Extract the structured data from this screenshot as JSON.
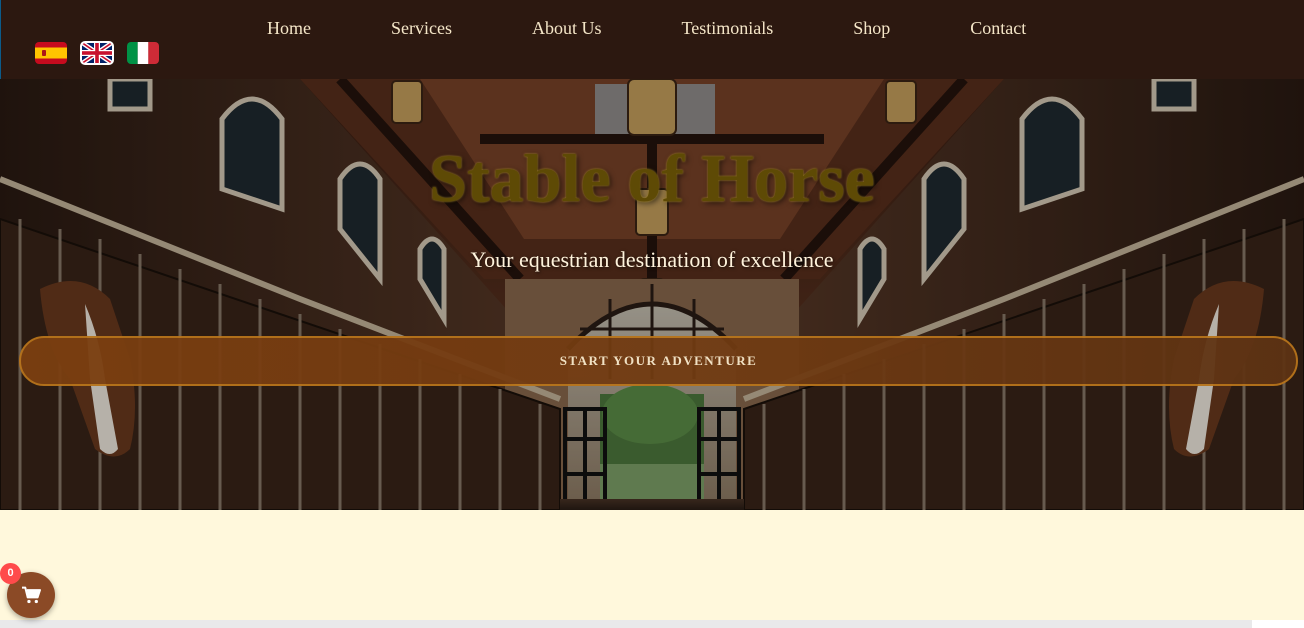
{
  "nav": {
    "items": [
      {
        "label": "Home"
      },
      {
        "label": "Services"
      },
      {
        "label": "About Us"
      },
      {
        "label": "Testimonials"
      },
      {
        "label": "Shop"
      },
      {
        "label": "Contact"
      }
    ]
  },
  "languages": [
    {
      "icon": "spain-flag-icon",
      "active": false
    },
    {
      "icon": "uk-flag-icon",
      "active": true
    },
    {
      "icon": "italy-flag-icon",
      "active": false
    }
  ],
  "hero": {
    "title": "Stable of Horse",
    "subtitle": "Your equestrian destination of excellence",
    "cta_label": "START YOUR ADVENTURE"
  },
  "cart": {
    "count": "0",
    "icon": "shopping-cart-icon"
  },
  "colors": {
    "header_bg": "#2c1810",
    "page_bg": "#fff8dc",
    "cta_bg": "#7c3f10",
    "cta_border": "#b8741b",
    "title_color": "#5e4a05",
    "cart_bg": "#8b4a26",
    "badge_bg": "#ff4b4b"
  }
}
